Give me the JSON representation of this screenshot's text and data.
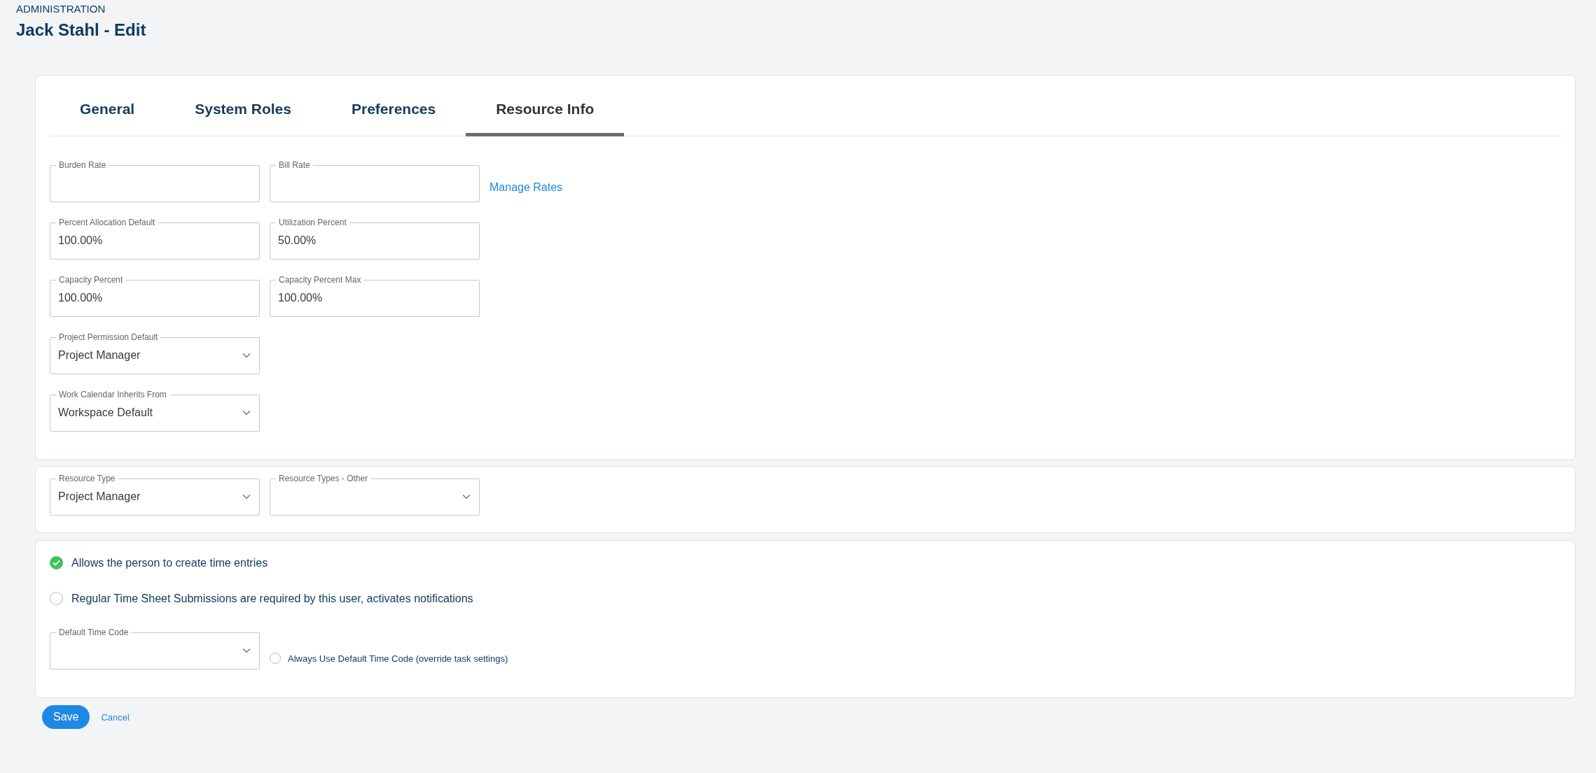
{
  "breadcrumb": "ADMINISTRATION",
  "title": "Jack Stahl - Edit",
  "tabs": [
    {
      "label": "General",
      "selected": false
    },
    {
      "label": "System Roles",
      "selected": false
    },
    {
      "label": "Preferences",
      "selected": false
    },
    {
      "label": "Resource Info",
      "selected": true
    }
  ],
  "rate_rows": [
    {
      "fields": [
        {
          "kind": "input",
          "label": "Burden Rate"
        },
        {
          "kind": "input",
          "label": "Bill Rate"
        }
      ],
      "link": "Manage Rates"
    },
    {
      "fields": [
        {
          "kind": "input",
          "label": "Percent Allocation Default",
          "value": "100.00%"
        },
        {
          "kind": "input",
          "label": "Utilization Percent",
          "value": "50.00%"
        }
      ]
    },
    {
      "fields": [
        {
          "kind": "input",
          "label": "Capacity Percent",
          "value": "100.00%"
        },
        {
          "kind": "input",
          "label": "Capacity Percent Max",
          "value": "100.00%"
        }
      ]
    },
    {
      "fields": [
        {
          "kind": "select",
          "label": "Project Permission Default",
          "value": "Project Manager"
        }
      ]
    },
    {
      "fields": [
        {
          "kind": "select",
          "label": "Work Calendar Inherits From",
          "value": "Workspace Default"
        }
      ]
    }
  ],
  "resource_fields": [
    {
      "kind": "select",
      "label": "Resource Type",
      "value": "Project Manager"
    },
    {
      "kind": "select",
      "label": "Resource Types - Other"
    }
  ],
  "time_options": [
    {
      "label": "Allows the person to create time entries",
      "checked": true
    },
    {
      "label": "Regular Time Sheet Submissions are required by this user, activates notifications",
      "checked": false
    }
  ],
  "default_time_code": {
    "kind": "select",
    "label": "Default Time Code"
  },
  "always_use_default": {
    "label": "Always Use Default Time Code (override task settings)",
    "checked": false
  },
  "save_button": "Save",
  "cancel_link": "Cancel"
}
